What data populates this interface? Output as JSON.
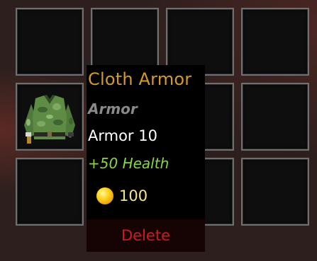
{
  "inventory": {
    "slots": [
      {
        "row": 0,
        "col": 0,
        "item": ""
      },
      {
        "row": 0,
        "col": 1,
        "item": ""
      },
      {
        "row": 0,
        "col": 2,
        "item": ""
      },
      {
        "row": 0,
        "col": 3,
        "item": ""
      },
      {
        "row": 1,
        "col": 0,
        "item": "cloth-armor"
      },
      {
        "row": 1,
        "col": 1,
        "item": ""
      },
      {
        "row": 1,
        "col": 2,
        "item": ""
      },
      {
        "row": 1,
        "col": 3,
        "item": ""
      },
      {
        "row": 2,
        "col": 0,
        "item": ""
      },
      {
        "row": 2,
        "col": 1,
        "item": ""
      },
      {
        "row": 2,
        "col": 2,
        "item": ""
      },
      {
        "row": 2,
        "col": 3,
        "item": ""
      }
    ],
    "slot_icon": "green-cloth-tunic-icon"
  },
  "tooltip": {
    "name": "Cloth Armor",
    "type": "Armor",
    "stat": "Armor 10",
    "bonus": "+50 Health",
    "price": "100",
    "coin_icon": "gold-coin-icon",
    "delete_label": "Delete"
  },
  "colors": {
    "name": "#d29a2a",
    "type": "#8a8a8a",
    "stat": "#ffffff",
    "bonus": "#86d93a",
    "price": "#f4e58a",
    "delete": "#d81818",
    "slot_border": "#6f6f6f",
    "slot_fill": "#0e0e0e"
  }
}
